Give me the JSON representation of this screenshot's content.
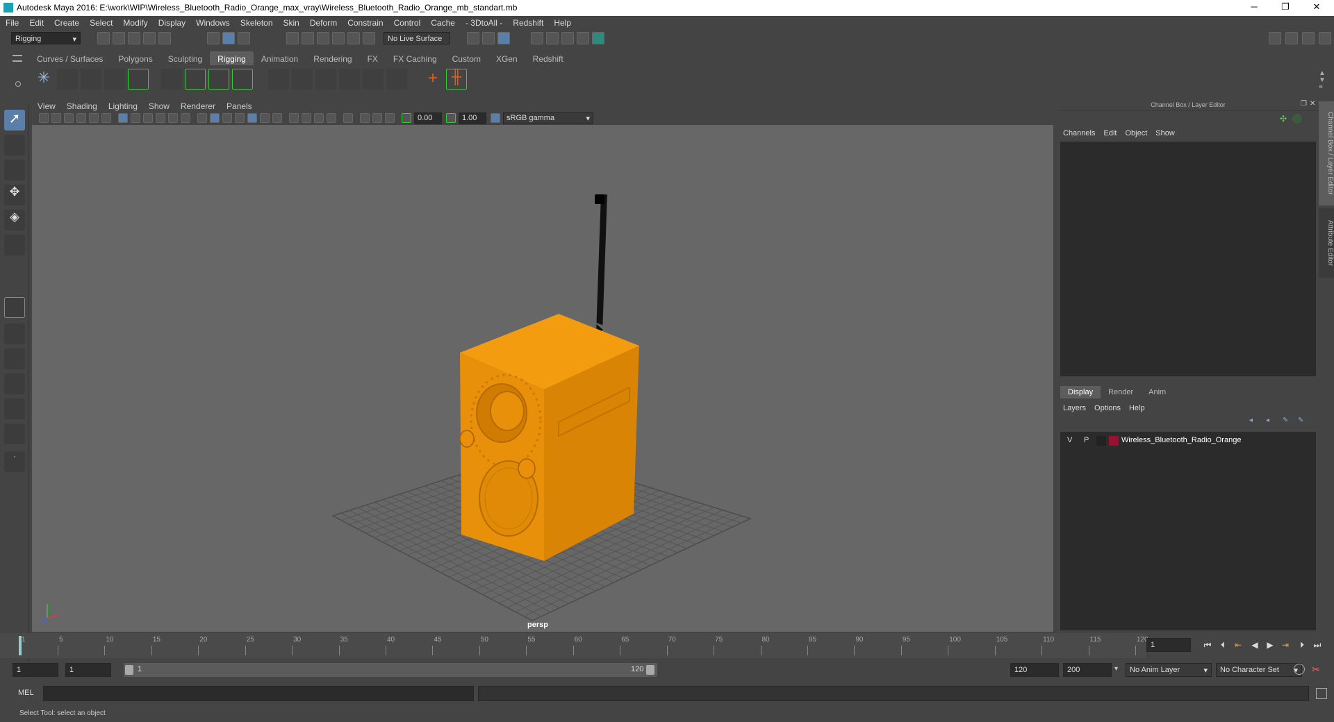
{
  "window": {
    "title": "Autodesk Maya 2016: E:\\work\\WIP\\Wireless_Bluetooth_Radio_Orange_max_vray\\Wireless_Bluetooth_Radio_Orange_mb_standart.mb",
    "minimize": "─",
    "maximize": "❐",
    "close": "✕"
  },
  "menubar": [
    "File",
    "Edit",
    "Create",
    "Select",
    "Modify",
    "Display",
    "Windows",
    "Skeleton",
    "Skin",
    "Deform",
    "Constrain",
    "Control",
    "Cache",
    "- 3DtoAll -",
    "Redshift",
    "Help"
  ],
  "statusline": {
    "mode": "Rigging",
    "live_surface": "No Live Surface"
  },
  "shelf": {
    "tabs": [
      "Curves / Surfaces",
      "Polygons",
      "Sculpting",
      "Rigging",
      "Animation",
      "Rendering",
      "FX",
      "FX Caching",
      "Custom",
      "XGen",
      "Redshift"
    ],
    "active": "Rigging"
  },
  "viewport": {
    "menu": [
      "View",
      "Shading",
      "Lighting",
      "Show",
      "Renderer",
      "Panels"
    ],
    "exposure": "0.00",
    "gamma": "1.00",
    "colorspace": "sRGB gamma",
    "camera_label": "persp"
  },
  "channelbox": {
    "title": "Channel Box / Layer Editor",
    "menu": [
      "Channels",
      "Edit",
      "Object",
      "Show"
    ]
  },
  "layereditor": {
    "tabs": [
      "Display",
      "Render",
      "Anim"
    ],
    "active": "Display",
    "menu": [
      "Layers",
      "Options",
      "Help"
    ],
    "layers": [
      {
        "v": "V",
        "p": "P",
        "name": "Wireless_Bluetooth_Radio_Orange",
        "color": "#9a1030"
      }
    ]
  },
  "sidetabs": [
    "Channel Box / Layer Editor",
    "Attribute Editor"
  ],
  "timeline": {
    "ticks": [
      "1",
      "5",
      "10",
      "15",
      "20",
      "25",
      "30",
      "35",
      "40",
      "45",
      "50",
      "55",
      "60",
      "65",
      "70",
      "75",
      "80",
      "85",
      "90",
      "95",
      "100",
      "105",
      "110",
      "115",
      "120"
    ],
    "current_frame": "1"
  },
  "range": {
    "start": "1",
    "anim_start": "1",
    "slider_start": "1",
    "slider_end": "120",
    "end": "120",
    "anim_end": "200",
    "anim_layer": "No Anim Layer",
    "char_set": "No Character Set"
  },
  "cmdline": {
    "label": "MEL"
  },
  "helpline": {
    "text": "Select Tool: select an object"
  }
}
